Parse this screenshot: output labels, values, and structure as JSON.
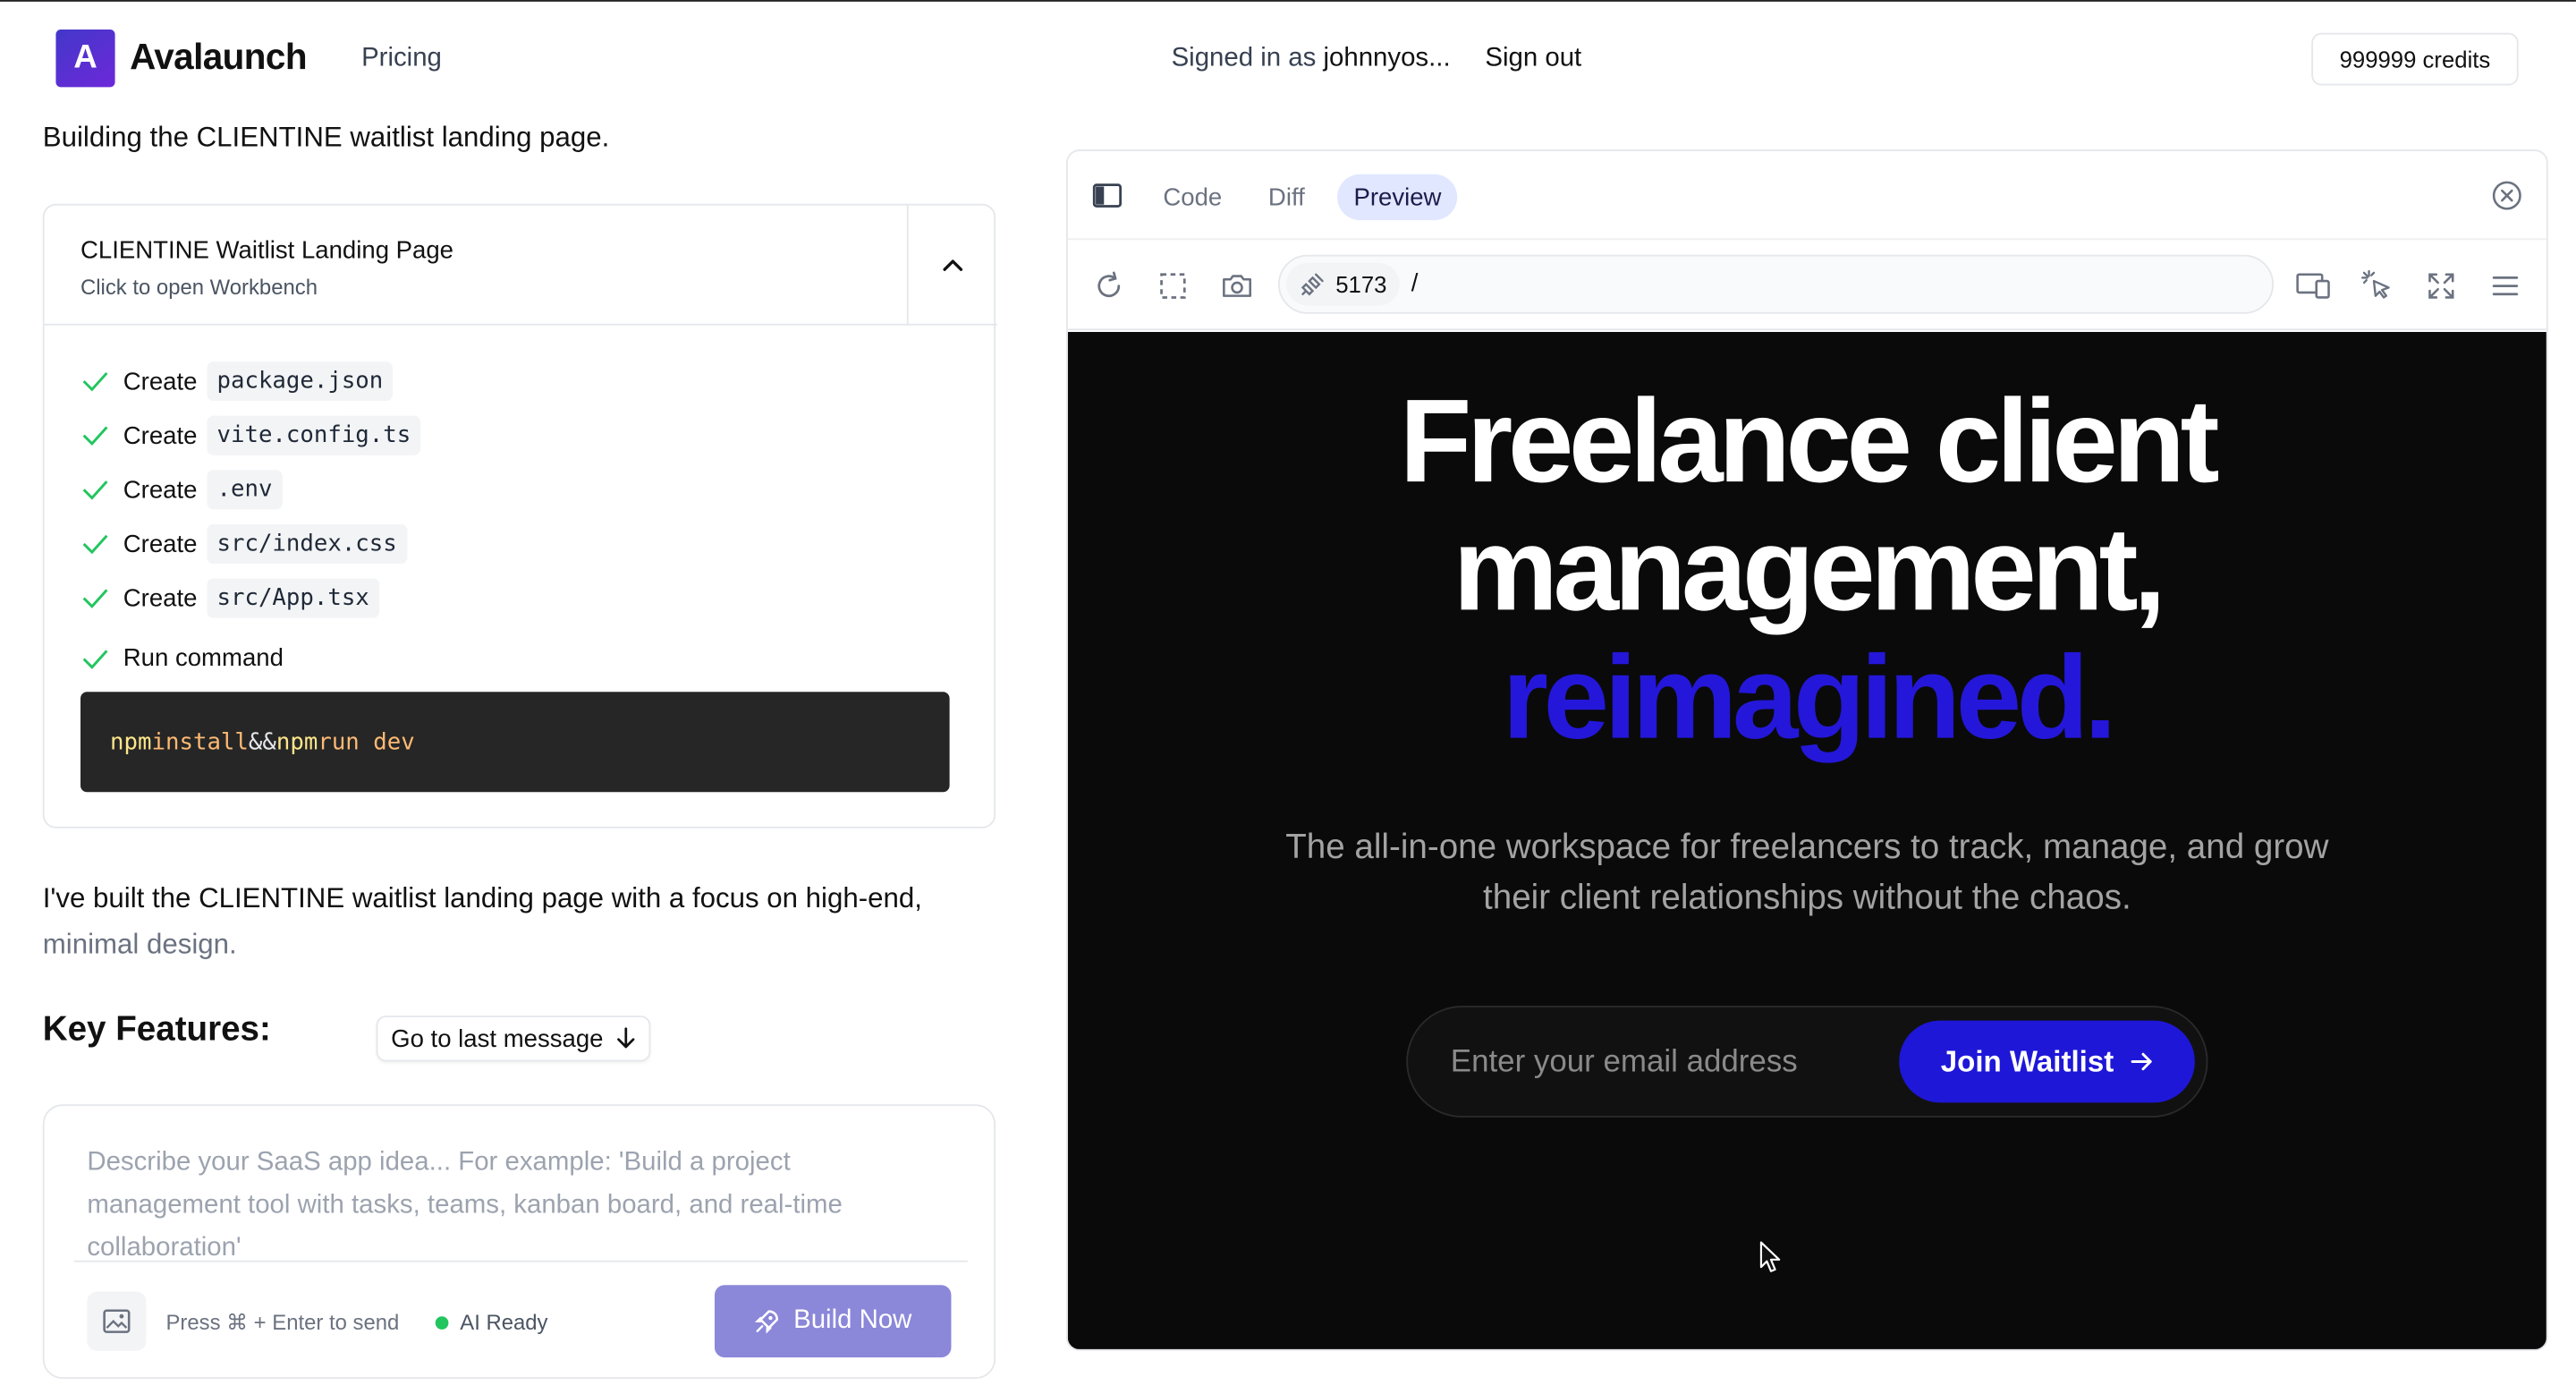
{
  "header": {
    "logo_letter": "A",
    "brand": "Avalaunch",
    "nav_pricing": "Pricing",
    "signed_prefix": "Signed in as",
    "username": "johnnyos...",
    "sign_out": "Sign out",
    "credits": "999999 credits"
  },
  "chat": {
    "building_text": "Building the CLIENTINE waitlist landing page.",
    "artifact": {
      "title": "CLIENTINE Waitlist Landing Page",
      "subtitle": "Click to open Workbench",
      "steps": [
        {
          "verb": "Create",
          "file": "package.json"
        },
        {
          "verb": "Create",
          "file": "vite.config.ts"
        },
        {
          "verb": "Create",
          "file": ".env"
        },
        {
          "verb": "Create",
          "file": "src/index.css"
        },
        {
          "verb": "Create",
          "file": "src/App.tsx"
        }
      ],
      "run_label": "Run command",
      "command": {
        "cmd1": "npm",
        "arg1": "install",
        "op": "&&",
        "cmd2": "npm",
        "arg2": "run dev"
      }
    },
    "message": "I've built the CLIENTINE waitlist landing page with a focus on high-end,",
    "message_fade": "minimal design.",
    "key_features": "Key Features:",
    "go_last": "Go to last message"
  },
  "composer": {
    "placeholder": "Describe your SaaS app idea...  For example: 'Build a project management tool with tasks, teams, kanban board, and real-time collaboration'",
    "hint": "Press ⌘ + Enter to send",
    "status": "AI Ready",
    "build_label": "Build Now",
    "colors": {
      "status_dot": "#22c55e",
      "build_bg": "#8b87d9"
    }
  },
  "workbench": {
    "tabs": [
      "Code",
      "Diff",
      "Preview"
    ],
    "active_tab": "Preview",
    "port": "5173",
    "path": "/",
    "icons": [
      "sidebar-toggle-icon",
      "close-circle-icon",
      "reload-icon",
      "select-region-icon",
      "camera-icon",
      "plug-icon",
      "responsive-devices-icon",
      "element-picker-icon",
      "fullscreen-icon",
      "menu-icon"
    ]
  },
  "preview": {
    "hero_line1": "Freelance client",
    "hero_line2": "management,",
    "hero_accent": "reimagined.",
    "subtitle": "The all-in-one workspace for freelancers to track, manage, and grow their client relationships without the chaos.",
    "email_placeholder": "Enter your email address",
    "join_label": "Join Waitlist",
    "colors": {
      "background": "#0a0a0a",
      "accent": "#2417d9",
      "button": "#1e17d8"
    }
  }
}
